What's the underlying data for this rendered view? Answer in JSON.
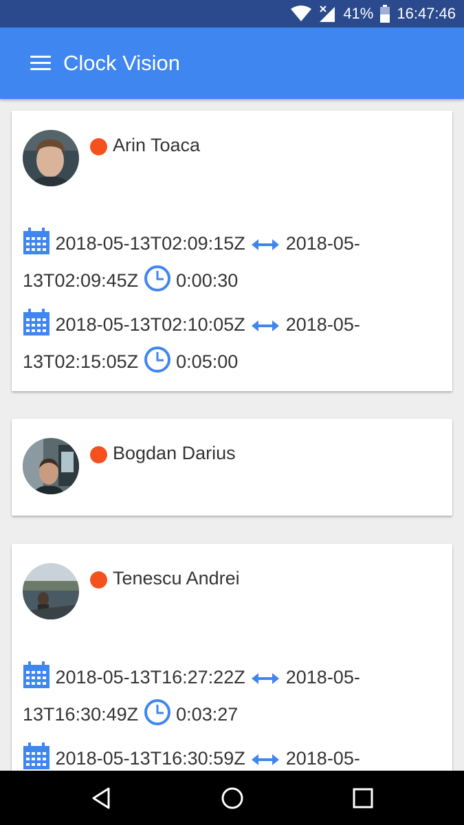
{
  "status_bar": {
    "battery": "41%",
    "time": "16:47:46"
  },
  "app_bar": {
    "title": "Clock Vision",
    "menu_icon": "hamburger-menu-icon"
  },
  "people": [
    {
      "name": "Arin Toaca",
      "status_color": "#f4511e",
      "entries": [
        {
          "start": "2018-05-13T02:09:15Z",
          "end_line1": "2018-05-",
          "end_line2": "13T02:09:45Z",
          "duration": "0:00:30"
        },
        {
          "start": "2018-05-13T02:10:05Z",
          "end_line1": "2018-05-",
          "end_line2": "13T02:15:05Z",
          "duration": "0:05:00"
        }
      ]
    },
    {
      "name": "Bogdan Darius",
      "status_color": "#f4511e",
      "entries": []
    },
    {
      "name": "Tenescu Andrei",
      "status_color": "#f4511e",
      "entries": [
        {
          "start": "2018-05-13T16:27:22Z",
          "end_line1": "2018-05-",
          "end_line2": "13T16:30:49Z",
          "duration": "0:03:27"
        },
        {
          "start": "2018-05-13T16:30:59Z",
          "end_line1": "2018-05-",
          "end_line2": "",
          "duration": ""
        }
      ]
    }
  ],
  "icons": {
    "calendar": "calendar-icon",
    "arrow": "double-arrow-icon",
    "clock": "clock-icon"
  },
  "colors": {
    "app_bar": "#3f86f0",
    "status_bar": "#2a4a8d",
    "icon_blue": "#3f86f0",
    "status_dot": "#f4511e"
  },
  "nav_bar": {
    "buttons": [
      "back-icon",
      "home-icon",
      "recents-icon"
    ]
  }
}
